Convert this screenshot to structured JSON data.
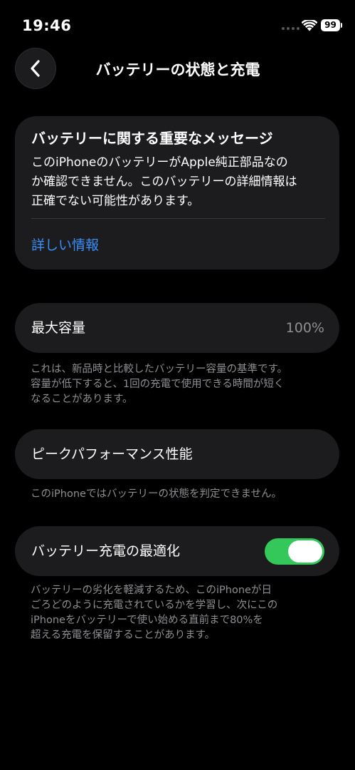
{
  "status_bar": {
    "time": "19:46",
    "battery_level": "99",
    "icons": [
      "signal-dots-icon",
      "wifi-icon",
      "battery-icon"
    ]
  },
  "nav": {
    "back_icon": "chevron-left-icon",
    "title": "バッテリーの状態と充電"
  },
  "message_card": {
    "title": "バッテリーに関する重要なメッセージ",
    "body": "このiPhoneのバッテリーがApple純正部品なの\nか確認できません。このバッテリーの詳細情報は\n正確でない可能性があります。",
    "link": "詳しい情報"
  },
  "maximum_capacity": {
    "label": "最大容量",
    "value": "100%",
    "footnote": "これは、新品時と比較したバッテリー容量の基準です。\n容量が低下すると、1回の充電で使用できる時間が短く\nなることがあります。"
  },
  "peak_performance": {
    "label": "ピークパフォーマンス性能",
    "footnote": "このiPhoneではバッテリーの状態を判定できません。"
  },
  "optimized_charging": {
    "label": "バッテリー充電の最適化",
    "enabled": true,
    "footnote": "バッテリーの劣化を軽減するため、このiPhoneが日\nごろどのように充電されているかを学習し、次にこの\niPhoneをバッテリーで使い始める直前まで80%を\n超える充電を保留することがあります。"
  },
  "colors": {
    "background": "#000000",
    "card": "#1c1c1e",
    "link": "#3a8ff7",
    "toggle_on": "#34c759",
    "secondary_text": "#8e8e93"
  }
}
